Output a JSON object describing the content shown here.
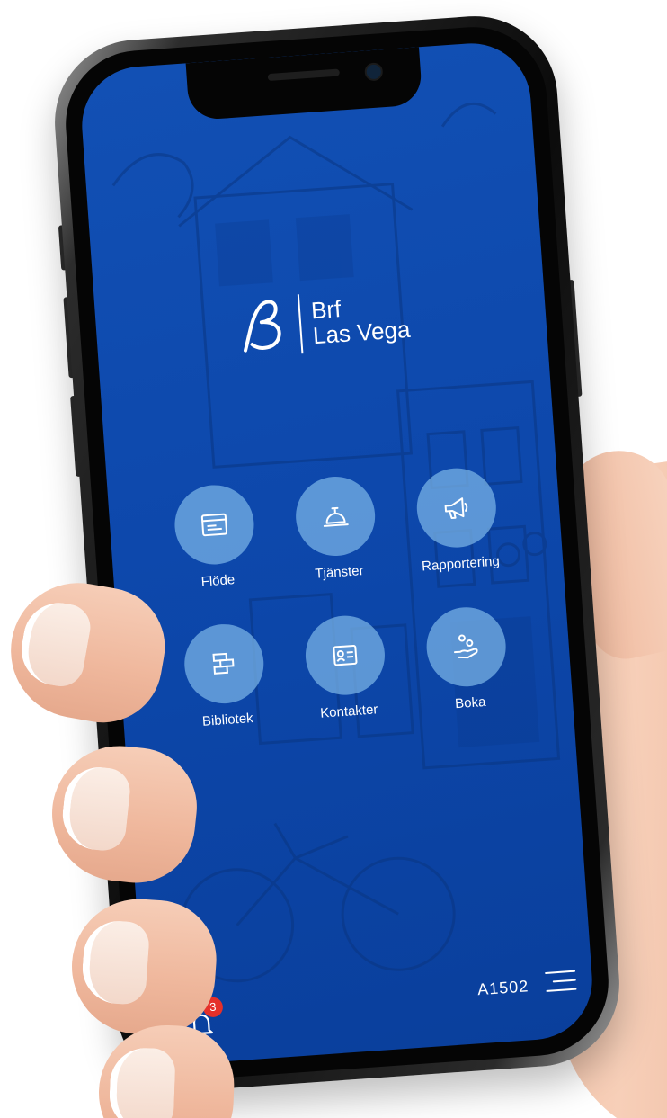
{
  "app": {
    "brand_line1": "Brf",
    "brand_line2": "Las Vega"
  },
  "menu": {
    "items": [
      {
        "label": "Flöde",
        "icon": "browser-window-icon"
      },
      {
        "label": "Tjänster",
        "icon": "service-bell-icon"
      },
      {
        "label": "Rapportering",
        "icon": "megaphone-icon"
      },
      {
        "label": "Bibliotek",
        "icon": "bricks-icon"
      },
      {
        "label": "Kontakter",
        "icon": "contact-card-icon"
      },
      {
        "label": "Boka",
        "icon": "hand-booking-icon"
      }
    ]
  },
  "footer": {
    "notification_count": "3",
    "apartment": "A1502",
    "menu_icon": "hamburger-menu-icon"
  },
  "colors": {
    "background": "#0d48ac",
    "tile": "#7cb6e8",
    "badge": "#e5302a",
    "text": "#ffffff"
  }
}
